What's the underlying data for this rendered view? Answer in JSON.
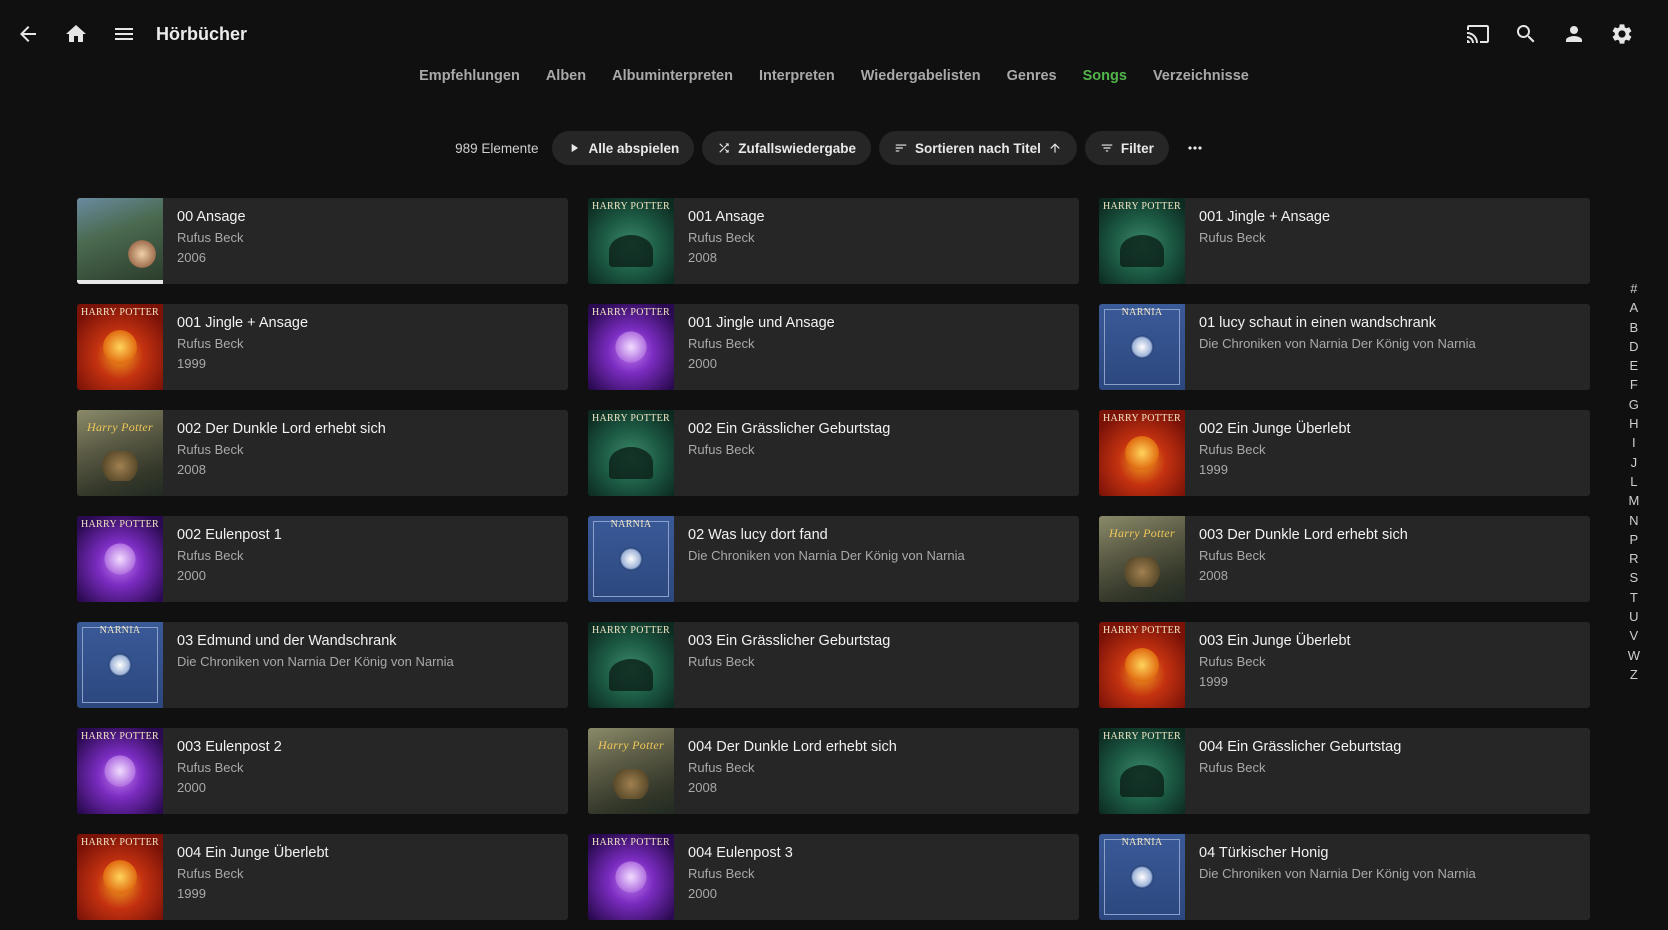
{
  "header": {
    "title": "Hörbücher"
  },
  "tabs": [
    {
      "label": "Empfehlungen",
      "active": false
    },
    {
      "label": "Alben",
      "active": false
    },
    {
      "label": "Albuminterpreten",
      "active": false
    },
    {
      "label": "Interpreten",
      "active": false
    },
    {
      "label": "Wiedergabelisten",
      "active": false
    },
    {
      "label": "Genres",
      "active": false
    },
    {
      "label": "Songs",
      "active": true
    },
    {
      "label": "Verzeichnisse",
      "active": false
    }
  ],
  "toolbar": {
    "count": "989 Elemente",
    "play_all": "Alle abspielen",
    "shuffle": "Zufallswiedergabe",
    "sort": "Sortieren nach Titel",
    "filter": "Filter"
  },
  "colors": {
    "accent": "#52b54b",
    "background": "#101010",
    "card": "#262626"
  },
  "songs": [
    {
      "title": "00 Ansage",
      "artist": "Rufus Beck",
      "year": "2006",
      "art": "hp1"
    },
    {
      "title": "001 Ansage",
      "artist": "Rufus Beck",
      "year": "2008",
      "art": "green",
      "cap": "HARRY POTTER"
    },
    {
      "title": "001 Jingle + Ansage",
      "artist": "Rufus Beck",
      "year": "",
      "art": "green",
      "cap": "HARRY POTTER"
    },
    {
      "title": "001 Jingle + Ansage",
      "artist": "Rufus Beck",
      "year": "1999",
      "art": "red",
      "cap": "HARRY POTTER"
    },
    {
      "title": "001 Jingle und Ansage",
      "artist": "Rufus Beck",
      "year": "2000",
      "art": "purple",
      "cap": "HARRY POTTER"
    },
    {
      "title": "01 lucy schaut in einen wandschrank",
      "artist": "Die Chroniken von Narnia Der König von Narnia",
      "year": "",
      "art": "blue",
      "cap": "NARNIA"
    },
    {
      "title": "002 Der Dunkle Lord erhebt sich",
      "artist": "Rufus Beck",
      "year": "2008",
      "art": "hp7",
      "cap": "Harry Potter"
    },
    {
      "title": "002 Ein Grässlicher Geburtstag",
      "artist": "Rufus Beck",
      "year": "",
      "art": "green",
      "cap": "HARRY POTTER"
    },
    {
      "title": "002 Ein Junge Überlebt",
      "artist": "Rufus Beck",
      "year": "1999",
      "art": "red",
      "cap": "HARRY POTTER"
    },
    {
      "title": "002 Eulenpost 1",
      "artist": "Rufus Beck",
      "year": "2000",
      "art": "purple",
      "cap": "HARRY POTTER"
    },
    {
      "title": "02 Was lucy dort fand",
      "artist": "Die Chroniken von Narnia Der König von Narnia",
      "year": "",
      "art": "blue",
      "cap": "NARNIA"
    },
    {
      "title": "003 Der Dunkle Lord erhebt sich",
      "artist": "Rufus Beck",
      "year": "2008",
      "art": "hp7",
      "cap": "Harry Potter"
    },
    {
      "title": "03 Edmund und der Wandschrank",
      "artist": "Die Chroniken von Narnia Der König von Narnia",
      "year": "",
      "art": "blue",
      "cap": "NARNIA"
    },
    {
      "title": "003 Ein Grässlicher Geburtstag",
      "artist": "Rufus Beck",
      "year": "",
      "art": "green",
      "cap": "HARRY POTTER"
    },
    {
      "title": "003 Ein Junge Überlebt",
      "artist": "Rufus Beck",
      "year": "1999",
      "art": "red",
      "cap": "HARRY POTTER"
    },
    {
      "title": "003 Eulenpost 2",
      "artist": "Rufus Beck",
      "year": "2000",
      "art": "purple",
      "cap": "HARRY POTTER"
    },
    {
      "title": "004 Der Dunkle Lord erhebt sich",
      "artist": "Rufus Beck",
      "year": "2008",
      "art": "hp7",
      "cap": "Harry Potter"
    },
    {
      "title": "004 Ein Grässlicher Geburtstag",
      "artist": "Rufus Beck",
      "year": "",
      "art": "green",
      "cap": "HARRY POTTER"
    },
    {
      "title": "004 Ein Junge Überlebt",
      "artist": "Rufus Beck",
      "year": "1999",
      "art": "red",
      "cap": "HARRY POTTER"
    },
    {
      "title": "004 Eulenpost 3",
      "artist": "Rufus Beck",
      "year": "2000",
      "art": "purple",
      "cap": "HARRY POTTER"
    },
    {
      "title": "04 Türkischer Honig",
      "artist": "Die Chroniken von Narnia Der König von Narnia",
      "year": "",
      "art": "blue",
      "cap": "NARNIA"
    }
  ],
  "alphabet": [
    "#",
    "A",
    "B",
    "D",
    "E",
    "F",
    "G",
    "H",
    "I",
    "J",
    "L",
    "M",
    "N",
    "P",
    "R",
    "S",
    "T",
    "U",
    "V",
    "W",
    "Z"
  ]
}
